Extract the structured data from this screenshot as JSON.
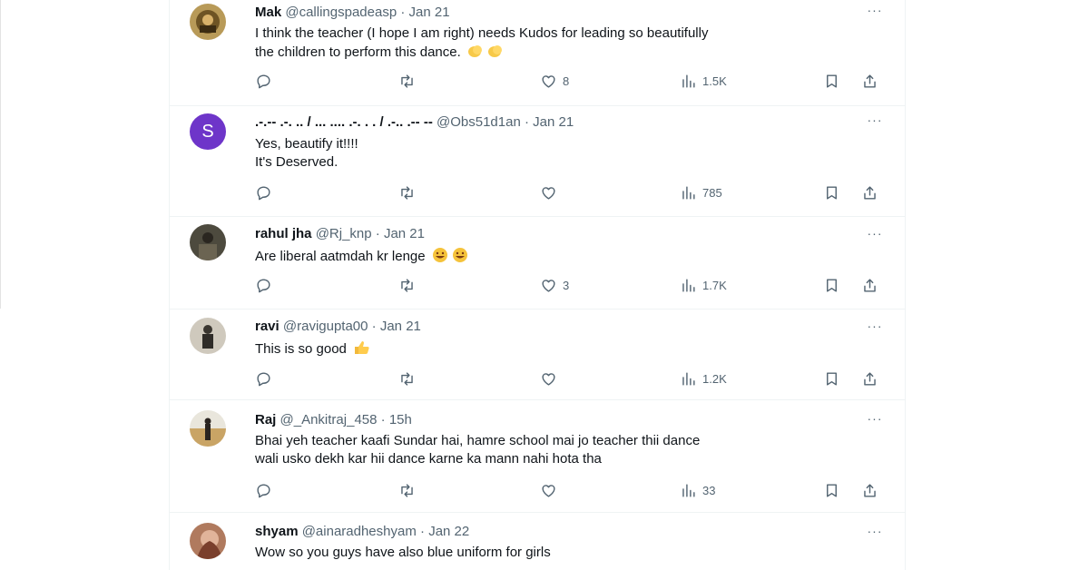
{
  "replies": [
    {
      "name": "Mak",
      "handle": "@callingspadeasp",
      "dot": "·",
      "time": "Jan 21",
      "lines": [
        "I think the teacher (I hope I am right) needs Kudos for leading so beautifully",
        "the children to perform this dance."
      ],
      "emoji": [
        "clapping-hands-icon",
        "clapping-hands-icon"
      ],
      "likes": "8",
      "views": "1.5K"
    },
    {
      "name": ".-.-- .-. .. / ... .... .-. . . / .-.. .-- --",
      "handle": "@Obs51d1an",
      "dot": "·",
      "time": "Jan 21",
      "avatar_letter": "S",
      "lines": [
        "Yes, beautify it!!!!",
        "It's Deserved."
      ],
      "likes": "",
      "views": "785"
    },
    {
      "name": "rahul jha",
      "handle": "@Rj_knp",
      "dot": "·",
      "time": "Jan 21",
      "lines": [
        "Are liberal aatmdah kr lenge"
      ],
      "emoji": [
        "rolling-laughing-icon",
        "rolling-laughing-icon"
      ],
      "likes": "3",
      "views": "1.7K"
    },
    {
      "name": "ravi",
      "handle": "@ravigupta00",
      "dot": "·",
      "time": "Jan 21",
      "lines": [
        "This is so good"
      ],
      "emoji": [
        "thumbs-up-icon"
      ],
      "likes": "",
      "views": "1.2K"
    },
    {
      "name": "Raj",
      "handle": "@_Ankitraj_458",
      "dot": "·",
      "time": "15h",
      "lines": [
        "Bhai yeh teacher kaafi Sundar hai, hamre school mai jo teacher thii dance",
        "wali usko dekh kar hii dance karne ka mann nahi hota tha"
      ],
      "likes": "",
      "views": "33"
    },
    {
      "name": "shyam",
      "handle": "@ainaradheshyam",
      "dot": "·",
      "time": "Jan 22",
      "lines": [
        "Wow so you guys have also blue uniform for girls"
      ]
    }
  ],
  "more_glyph": "···",
  "icons": [
    "reply-icon",
    "retweet-icon",
    "like-icon",
    "views-icon",
    "bookmark-icon",
    "share-icon"
  ],
  "colors": {
    "text": "#0f1419",
    "secondary": "#536471",
    "divider": "#eff3f4",
    "avatar_letter_bg": "#6e35c9"
  }
}
